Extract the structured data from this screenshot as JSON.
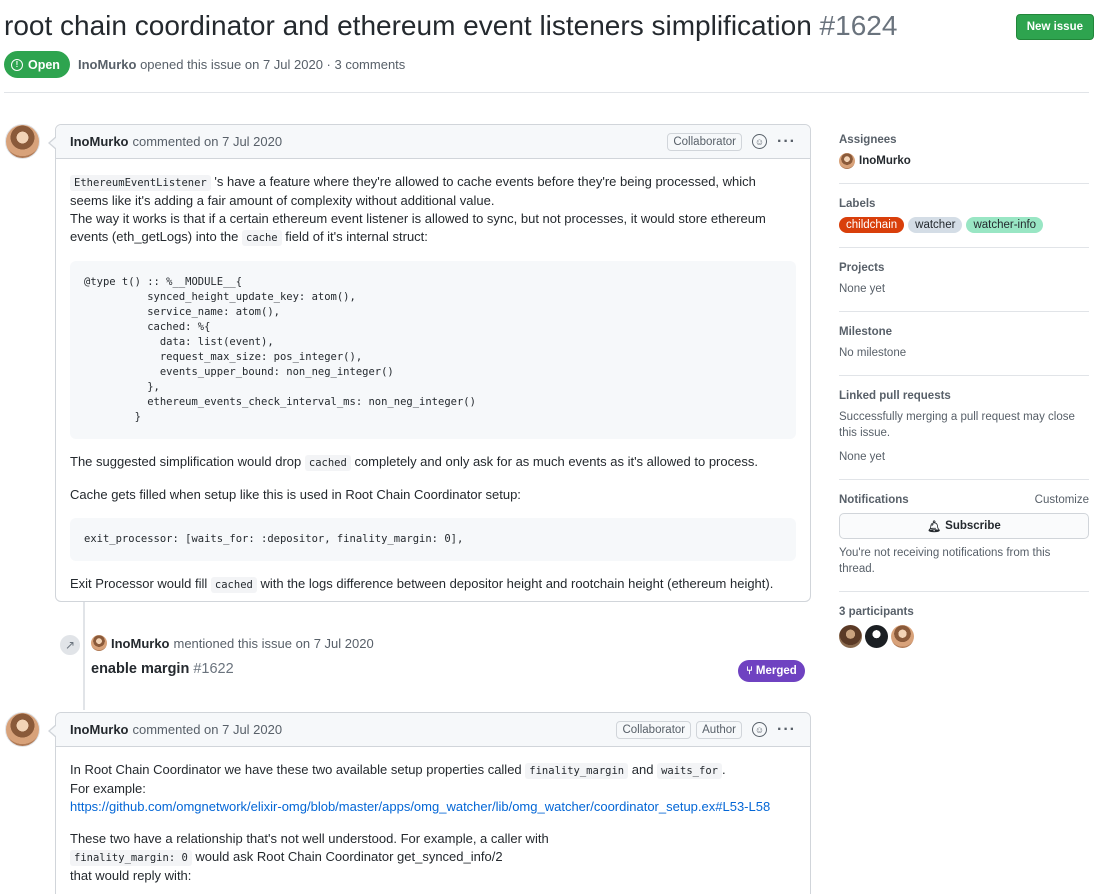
{
  "issue": {
    "title": "root chain coordinator and ethereum event listeners simplification",
    "number": "#1624",
    "state": "Open",
    "author": "InoMurko",
    "opened_text": "opened this issue on 7 Jul 2020 · 3 comments",
    "new_issue_label": "New issue"
  },
  "comments": [
    {
      "author": "InoMurko",
      "when": "commented on 7 Jul 2020",
      "badges": [
        "Collaborator"
      ],
      "p1_code": "EthereumEventListener",
      "p1_a": "'s have a feature where they're allowed to cache events before they're being processed, which seems like it's adding a fair amount of complexity without additional value.",
      "p1_b": "The way it works is that if a certain ethereum event listener is allowed to sync, but not processes, it would store ethereum events (eth_getLogs) into the",
      "p1_code2": "cache",
      "p1_c": "field of it's internal struct:",
      "code1": "@type t() :: %__MODULE__{\n          synced_height_update_key: atom(),\n          service_name: atom(),\n          cached: %{\n            data: list(event),\n            request_max_size: pos_integer(),\n            events_upper_bound: non_neg_integer()\n          },\n          ethereum_events_check_interval_ms: non_neg_integer()\n        }",
      "p2_a": "The suggested simplification would drop",
      "p2_code": "cached",
      "p2_b": "completely and only ask for as much events as it's allowed to process.",
      "p3": "Cache gets filled when setup like this is used in Root Chain Coordinator setup:",
      "code2": "exit_processor: [waits_for: :depositor, finality_margin: 0],",
      "p4_a": "Exit Processor would fill",
      "p4_code": "cached",
      "p4_b": "with the logs difference between depositor height and rootchain height (ethereum height)."
    },
    {
      "author": "InoMurko",
      "when": "commented on 7 Jul 2020",
      "badges": [
        "Collaborator",
        "Author"
      ],
      "p1_a": "In Root Chain Coordinator we have these two available setup properties called",
      "p1_code": "finality_margin",
      "p1_b": "and",
      "p1_code2": "waits_for",
      "p1_c": ".",
      "p1_d": "For example:",
      "link": "https://github.com/omgnetwork/elixir-omg/blob/master/apps/omg_watcher/lib/omg_watcher/coordinator_setup.ex#L53-L58",
      "p2_a": "These two have a relationship that's not well understood. For example, a caller with",
      "p2_code": "finality_margin: 0",
      "p2_b": "would ask Root Chain Coordinator get_synced_info/2",
      "p2_c": "that would reply with:"
    }
  ],
  "event": {
    "actor": "InoMurko",
    "text": "mentioned this issue on 7 Jul 2020",
    "pr_title": "enable margin",
    "pr_number": "#1622",
    "pr_state": "Merged"
  },
  "sidebar": {
    "assignees": {
      "heading": "Assignees",
      "name": "InoMurko"
    },
    "labels": {
      "heading": "Labels",
      "items": [
        {
          "name": "childchain",
          "bg": "#d93f0b",
          "fg": "#ffffff"
        },
        {
          "name": "watcher",
          "bg": "#d4dde6",
          "fg": "#24292e"
        },
        {
          "name": "watcher-info",
          "bg": "#99e6c4",
          "fg": "#24292e"
        }
      ]
    },
    "projects": {
      "heading": "Projects",
      "value": "None yet"
    },
    "milestone": {
      "heading": "Milestone",
      "value": "No milestone"
    },
    "linked_prs": {
      "heading": "Linked pull requests",
      "desc": "Successfully merging a pull request may close this issue.",
      "value": "None yet"
    },
    "notifications": {
      "heading": "Notifications",
      "customize": "Customize",
      "subscribe": "Subscribe",
      "desc": "You're not receiving notifications from this thread."
    },
    "participants": {
      "heading": "3 participants"
    }
  }
}
